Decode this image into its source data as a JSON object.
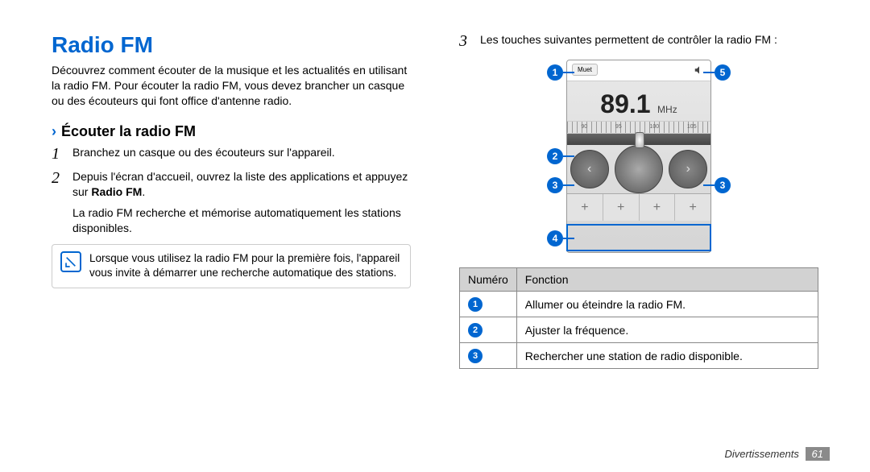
{
  "left": {
    "title": "Radio FM",
    "intro": "Découvrez comment écouter de la musique et les actualités en utilisant la radio FM. Pour écouter la radio FM, vous devez brancher un casque ou des écouteurs qui font office d'antenne radio.",
    "subhead": "Écouter la radio FM",
    "steps": {
      "s1_num": "1",
      "s1": "Branchez un casque ou des écouteurs sur l'appareil.",
      "s2_num": "2",
      "s2a": "Depuis l'écran d'accueil, ouvrez la liste des applications et appuyez sur ",
      "s2b_bold": "Radio FM",
      "s2c": ".",
      "s2_sub": "La radio FM recherche et mémorise automatiquement les stations disponibles."
    },
    "note": "Lorsque vous utilisez la radio FM pour la première fois, l'appareil vous invite à démarrer une recherche automatique des stations."
  },
  "right": {
    "lead_num": "3",
    "lead": "Les touches suivantes permettent de contrôler la radio FM :",
    "radio": {
      "muet": "Muet",
      "freq": "89.1",
      "unit": "MHz",
      "ticks": [
        "90",
        "95",
        "100",
        "105"
      ]
    },
    "badges": {
      "b1": "1",
      "b2": "2",
      "b3": "3",
      "b4": "4",
      "b5": "5"
    },
    "table": {
      "h1": "Numéro",
      "h2": "Fonction",
      "rows": [
        {
          "n": "1",
          "f": "Allumer ou éteindre la radio FM."
        },
        {
          "n": "2",
          "f": "Ajuster la fréquence."
        },
        {
          "n": "3",
          "f": "Rechercher une station de radio disponible."
        }
      ]
    }
  },
  "footer": {
    "section": "Divertissements",
    "page": "61"
  }
}
